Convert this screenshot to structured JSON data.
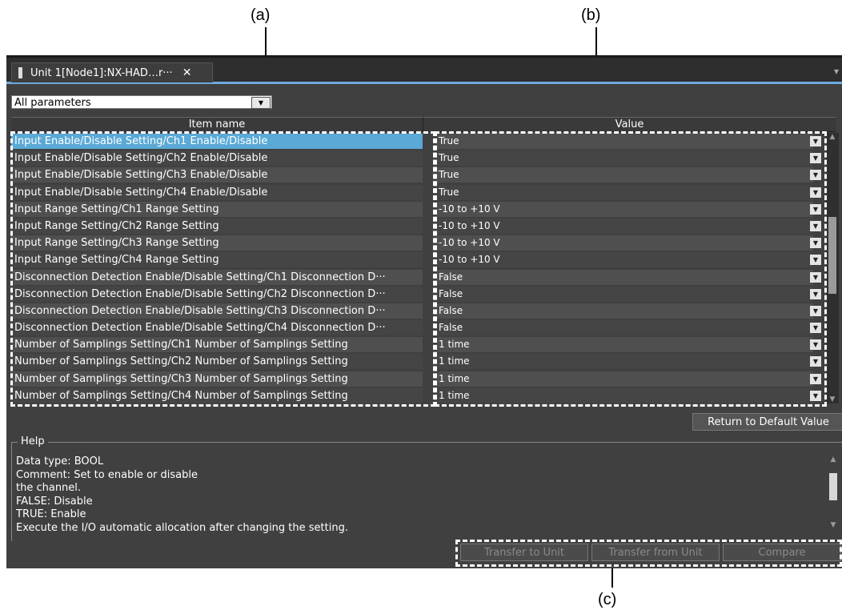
{
  "callouts": {
    "a": "(a)",
    "b": "(b)",
    "c": "(c)"
  },
  "tab": {
    "title": "Unit 1[Node1]:NX-HAD…r···",
    "close": "✕"
  },
  "filter": {
    "value": "All parameters",
    "arrow": "▼"
  },
  "table": {
    "headers": {
      "item_name": "Item name",
      "value": "Value"
    },
    "rows": [
      {
        "name": "Input Enable/Disable Setting/Ch1 Enable/Disable",
        "value": "True"
      },
      {
        "name": "Input Enable/Disable Setting/Ch2 Enable/Disable",
        "value": "True"
      },
      {
        "name": "Input Enable/Disable Setting/Ch3 Enable/Disable",
        "value": "True"
      },
      {
        "name": "Input Enable/Disable Setting/Ch4 Enable/Disable",
        "value": "True"
      },
      {
        "name": "Input Range Setting/Ch1 Range Setting",
        "value": "-10 to +10 V"
      },
      {
        "name": "Input Range Setting/Ch2 Range Setting",
        "value": "-10 to +10 V"
      },
      {
        "name": "Input Range Setting/Ch3 Range Setting",
        "value": "-10 to +10 V"
      },
      {
        "name": "Input Range Setting/Ch4 Range Setting",
        "value": "-10 to +10 V"
      },
      {
        "name": "Disconnection Detection Enable/Disable Setting/Ch1 Disconnection D···",
        "value": "False"
      },
      {
        "name": "Disconnection Detection Enable/Disable Setting/Ch2 Disconnection D···",
        "value": "False"
      },
      {
        "name": "Disconnection Detection Enable/Disable Setting/Ch3 Disconnection D···",
        "value": "False"
      },
      {
        "name": "Disconnection Detection Enable/Disable Setting/Ch4 Disconnection D···",
        "value": "False"
      },
      {
        "name": "Number of Samplings Setting/Ch1 Number of Samplings Setting",
        "value": "1 time"
      },
      {
        "name": "Number of Samplings Setting/Ch2 Number of Samplings Setting",
        "value": "1 time"
      },
      {
        "name": "Number of Samplings Setting/Ch3 Number of Samplings Setting",
        "value": "1 time"
      },
      {
        "name": "Number of Samplings Setting/Ch4 Number of Samplings Setting",
        "value": "1 time"
      }
    ],
    "selected_row": 0
  },
  "buttons": {
    "return_default": "Return to Default Value",
    "transfer_to_unit": "Transfer to Unit",
    "transfer_from_unit": "Transfer from Unit",
    "compare": "Compare"
  },
  "help": {
    "title": "Help",
    "lines": [
      "Data type: BOOL",
      "Comment: Set to enable or disable",
      "the channel.",
      "FALSE: Disable",
      "TRUE: Enable",
      "Execute the I/O automatic allocation after changing the setting."
    ]
  },
  "colors": {
    "selection": "#5aa9d6",
    "tab_accent": "#6ea8dc",
    "panel": "#404040"
  }
}
